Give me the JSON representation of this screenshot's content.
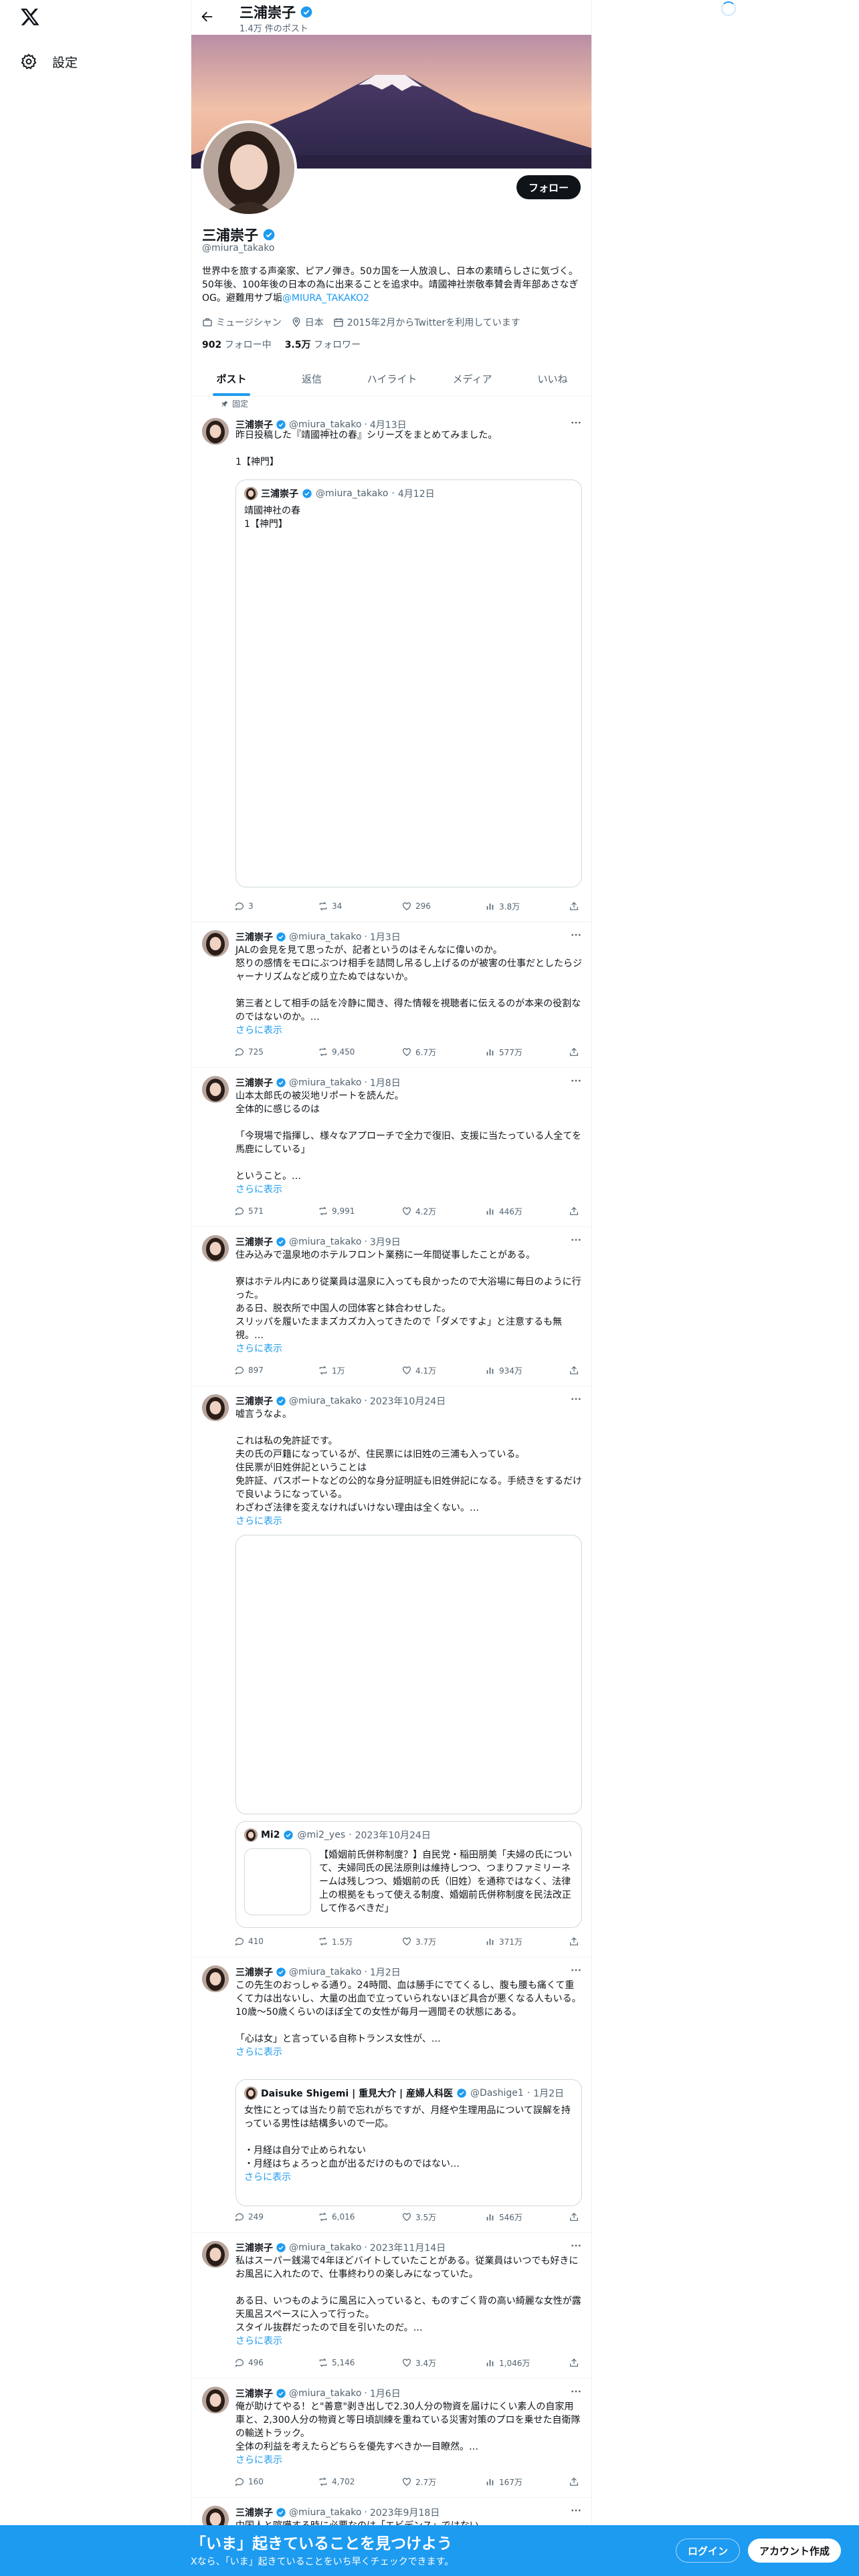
{
  "nav": {
    "settings_label": "設定"
  },
  "profile": {
    "name": "三浦崇子",
    "post_count": "1.4万 件のポスト",
    "handle": "@miura_takako",
    "follow_label": "フォロー",
    "bio": "世界中を旅する声楽家、ピアノ弾き。50カ国を一人放浪し、日本の素晴らしさに気づく。50年後、100年後の日本の為に出来ることを追求中。靖國神社崇敬奉賛会青年部あさなぎOG。避難用サブ垢",
    "bio_link": "@MIURA_TAKAKO2",
    "profession": "ミュージシャン",
    "location": "日本",
    "joined": "2015年2月からTwitterを利用しています",
    "following_count": "902",
    "following_label": "フォロー中",
    "followers_count": "3.5万",
    "followers_label": "フォロワー"
  },
  "tabs": [
    "ポスト",
    "返信",
    "ハイライト",
    "メディア",
    "いいね"
  ],
  "pinned_label": "固定",
  "tweets": [
    {
      "name": "三浦崇子",
      "handle": "@miura_takako",
      "date": "4月13日",
      "text": "昨日投稿した『靖國神社の春』シリーズをまとめてみました。\n\n1【神門】",
      "quote": {
        "name": "三浦崇子",
        "handle": "@miura_takako",
        "date": "4月12日",
        "text": "靖國神社の春\n1【神門】"
      },
      "replies": "3",
      "reposts": "34",
      "likes": "296",
      "views": "3.8万"
    },
    {
      "name": "三浦崇子",
      "handle": "@miura_takako",
      "date": "1月3日",
      "text": "JALの会見を見て思ったが、記者というのはそんなに偉いのか。\n怒りの感情をモロにぶつけ相手を詰問し吊るし上げるのが被害の仕事だとしたらジャーナリズムなど成り立たぬではないか。\n\n第三者として相手の話を冷静に聞き、得た情報を視聴者に伝えるのが本来の役割なのではないのか。…",
      "show_more": "さらに表示",
      "replies": "725",
      "reposts": "9,450",
      "likes": "6.7万",
      "views": "577万"
    },
    {
      "name": "三浦崇子",
      "handle": "@miura_takako",
      "date": "1月8日",
      "text": "山本太郎氏の被災地リポートを読んだ。\n全体的に感じるのは\n\n「今現場で指揮し、様々なアプローチで全力で復旧、支援に当たっている人全てを馬鹿にしている」\n\nということ。…",
      "show_more": "さらに表示",
      "replies": "571",
      "reposts": "9,991",
      "likes": "4.2万",
      "views": "446万"
    },
    {
      "name": "三浦崇子",
      "handle": "@miura_takako",
      "date": "3月9日",
      "text": "住み込みで温泉地のホテルフロント業務に一年間従事したことがある。\n\n寮はホテル内にあり従業員は温泉に入っても良かったので大浴場に毎日のように行った。\nある日、脱衣所で中国人の団体客と鉢合わせした。\nスリッパを履いたままズカズカ入ってきたので「ダメですよ」と注意するも無視。…",
      "show_more": "さらに表示",
      "replies": "897",
      "reposts": "1万",
      "likes": "4.1万",
      "views": "934万"
    },
    {
      "name": "三浦崇子",
      "handle": "@miura_takako",
      "date": "2023年10月24日",
      "text": "嘘言うなよ。\n\nこれは私の免許証です。\n夫の氏の戸籍になっているが、住民票には旧姓の三浦も入っている。\n住民票が旧姓併記ということは\n免許証、パスポートなどの公的な身分証明証も旧姓併記になる。手続きをするだけで良いようになっている。\nわざわざ法律を変えなければいけない理由は全くない。…",
      "show_more": "さらに表示",
      "quote": {
        "name": "Mi2",
        "handle": "@mi2_yes",
        "date": "2023年10月24日",
        "text": "【婚姻前氏併称制度？】自民党・稲田朋美「夫婦の氏について、夫婦同氏の民法原則は維持しつつ、つまりファミリーネームは残しつつ、婚姻前の氏（旧姓）を通称ではなく、法律上の根拠をもって使える制度、婚姻前氏併称制度を民法改正して作るべきだ」"
      },
      "replies": "410",
      "reposts": "1.5万",
      "likes": "3.7万",
      "views": "371万"
    },
    {
      "name": "三浦崇子",
      "handle": "@miura_takako",
      "date": "1月2日",
      "text": "この先生のおっしゃる通り。24時間、血は勝手にでてくるし、腹も腰も痛くて重くて力は出ないし、大量の出血で立っていられないほど具合が悪くなる人もいる。\n10歳〜50歳くらいのほぼ全ての女性が毎月一週間その状態にある。\n\n「心は女」と言っている自称トランス女性が、…",
      "show_more": "さらに表示",
      "quote": {
        "name": "Daisuke Shigemi | 重見大介 | 産婦人科医",
        "handle": "@Dashige1",
        "date": "1月2日",
        "text": "女性にとっては当たり前で忘れがちですが、月経や生理用品について誤解を持っている男性は結構多いので一応。\n\n・月経は自分で止められない\n・月経はちょろっと血が出るだけのものではない…",
        "show_more": "さらに表示"
      },
      "replies": "249",
      "reposts": "6,016",
      "likes": "3.5万",
      "views": "546万"
    },
    {
      "name": "三浦崇子",
      "handle": "@miura_takako",
      "date": "2023年11月14日",
      "text": "私はスーパー銭湯で4年ほどバイトしていたことがある。従業員はいつでも好きにお風呂に入れたので、仕事終わりの楽しみになっていた。\n\nある日、いつものように風呂に入っていると、ものすごく背の高い綺麗な女性が露天風呂スペースに入って行った。\nスタイル抜群だったので目を引いたのだ。…",
      "show_more": "さらに表示",
      "replies": "496",
      "reposts": "5,146",
      "likes": "3.4万",
      "views": "1,046万"
    },
    {
      "name": "三浦崇子",
      "handle": "@miura_takako",
      "date": "1月6日",
      "text": "俺が助けてやる！と\"善意\"剥き出しで2.30人分の物資を届けにくい素人の自家用車と、2,300人分の物資と等日頃訓練を重ねている災害対策のプロを乗せた自衛隊の輸送トラック。\n全体の利益を考えたらどちらを優先すべきか一目瞭然。…",
      "show_more": "さらに表示",
      "replies": "160",
      "reposts": "4,702",
      "likes": "2.7万",
      "views": "167万"
    },
    {
      "name": "三浦崇子",
      "handle": "@miura_takako",
      "date": "2023年9月18日",
      "text": "中国人と喧嘩する時に必要なのは「エビデンス」ではない。"
    }
  ],
  "bottom_bar": {
    "title": "「いま」起きていることを見つけよう",
    "subtitle": "Xなら、「いま」起きていることをいち早くチェックできます。",
    "login": "ログイン",
    "signup": "アカウント作成"
  },
  "colors": {
    "accent": "#1d9bf0",
    "text": "#0f1419",
    "secondary": "#536471",
    "border": "#eff3f4"
  }
}
